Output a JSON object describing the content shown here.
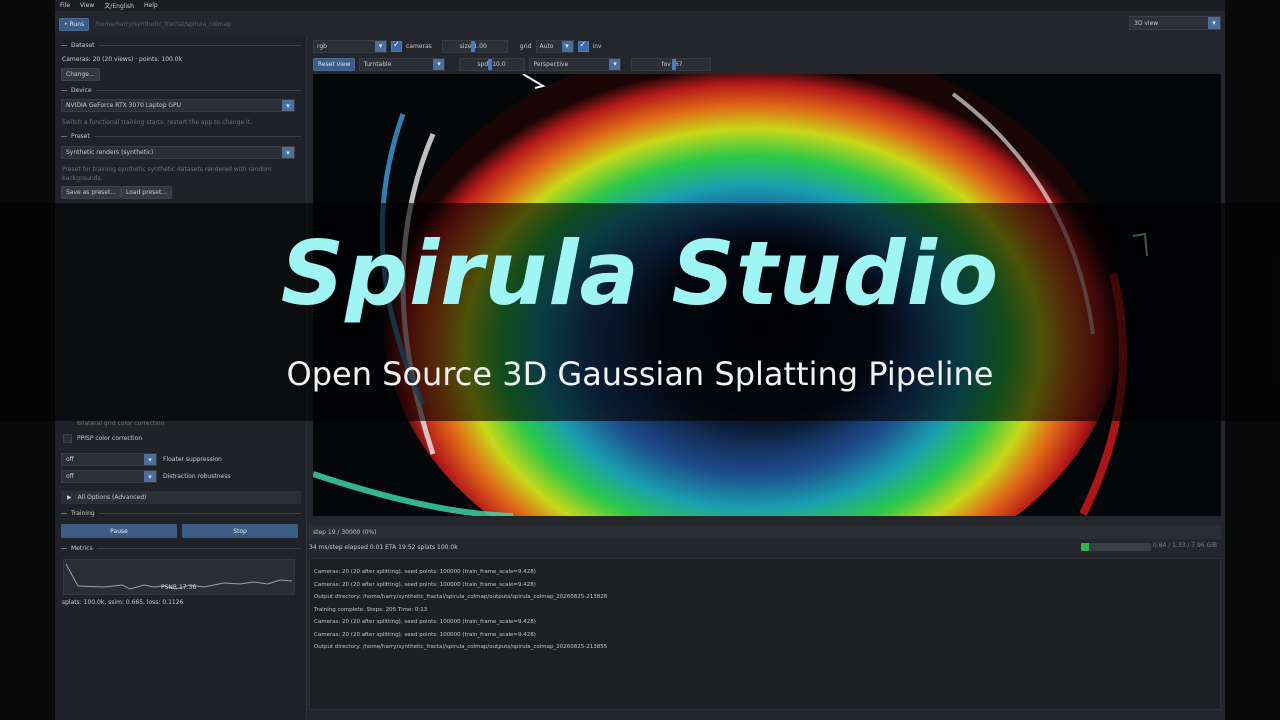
{
  "menu": [
    "File",
    "View",
    "文/English",
    "Help"
  ],
  "pathbar": {
    "button": "• Runs",
    "path": "/home/harry/synthetic_fractal/spirula_colmap",
    "view_mode": "3D view"
  },
  "sidebar": {
    "dataset_title": "Dataset",
    "dataset_info": "Cameras: 20 (20 views) · points: 100.0k",
    "change_button": "Change...",
    "device_title": "Device",
    "device_value": "NVIDIA GeForce RTX 3070 Laptop GPU",
    "device_hint": "Switch a functional training starts: restart the app to change it.",
    "preset_title": "Preset",
    "preset_value": "Synthetic renders (synthetic)",
    "preset_hint": "Preset for training synthetic synthetic datasets rendered with random backgrounds.",
    "save_preset": "Save as preset...",
    "load_preset": "Load preset...",
    "bilateral": "Bilateral grid color correction",
    "ppisp": "PPISP color correction",
    "floater_value": "off",
    "floater_label": "Floater suppression",
    "distraction_value": "off",
    "distraction_label": "Distraction robustness",
    "all_options": "All Options (Advanced)",
    "training_title": "Training",
    "pause_button": "Pause",
    "stop_button": "Stop",
    "metrics_title": "Metrics",
    "psnr_label": "PSNR 17.36",
    "metrics_text": "splats: 100.0k, ssim: 0.665, loss: 0.1126"
  },
  "toolbar": {
    "render_mode": "rgb",
    "cameras_label": "cameras",
    "size_label": "size",
    "size_value": "1.00",
    "grid_label": "grid",
    "grid_value": "Auto",
    "inv_label": "inv",
    "reset_view": "Reset view",
    "nav_mode": "Turntable",
    "spd_label": "spd",
    "spd_value": "10.0",
    "projection": "Perspective",
    "fov_label": "fov",
    "fov_value": "67"
  },
  "progress": {
    "text": "step 19 / 30000  (0%)",
    "fraction": 0.0006
  },
  "status": {
    "text": "34 ms/step   elapsed 0:01   ETA 19:52   splats 100.0k",
    "memory": "0.84 / 1.33 / 7.96 GiB",
    "memory_fraction": 0.12
  },
  "log_lines": [
    "Cameras: 20 (20 after splitting), seed points: 100000 (train_frame_scale=9.428)",
    "Cameras: 20 (20 after splitting), seed points: 100000 (train_frame_scale=9.428)",
    "Output directory: /home/harry/synthetic_fractal/spirula_colmap/outputs/spirula_colmap_20260825-213828",
    "Training complete. Steps: 205  Time: 0:13",
    "Cameras: 20 (20 after splitting), seed points: 100000 (train_frame_scale=9.428)",
    "Cameras: 20 (20 after splitting), seed points: 100000 (train_frame_scale=9.428)",
    "Output directory: /home/harry/synthetic_fractal/spirula_colmap/outputs/spirula_colmap_20260825-213855"
  ],
  "overlay": {
    "title": "Spirula Studio",
    "subtitle": "Open Source 3D Gaussian Splatting Pipeline"
  },
  "colors": {
    "accent": "#3c5d86",
    "title": "#9ff4f4",
    "memory": "#34b24e"
  }
}
